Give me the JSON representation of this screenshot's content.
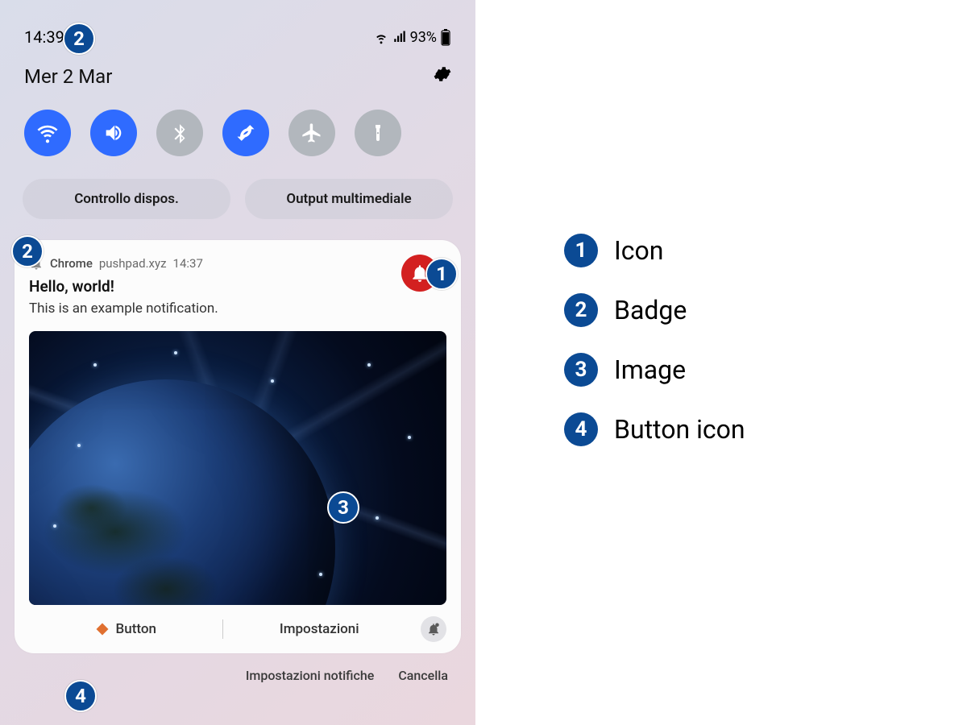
{
  "status": {
    "time": "14:39",
    "battery": "93%"
  },
  "date": "Mer 2 Mar",
  "panel_buttons": [
    "Controllo dispos.",
    "Output multimediale"
  ],
  "notification": {
    "app": "Chrome",
    "domain": "pushpad.xyz",
    "time": "14:37",
    "title": "Hello, world!",
    "body": "This is an example notification.",
    "action1": "Button",
    "action2": "Impostazioni"
  },
  "bottom": {
    "settings": "Impostazioni notifiche",
    "clear": "Cancella"
  },
  "legend": [
    {
      "n": "1",
      "label": "Icon"
    },
    {
      "n": "2",
      "label": "Badge"
    },
    {
      "n": "3",
      "label": "Image"
    },
    {
      "n": "4",
      "label": "Button icon"
    }
  ],
  "annotations": {
    "a1": "1",
    "a2a": "2",
    "a2b": "2",
    "a3": "3",
    "a4": "4"
  }
}
